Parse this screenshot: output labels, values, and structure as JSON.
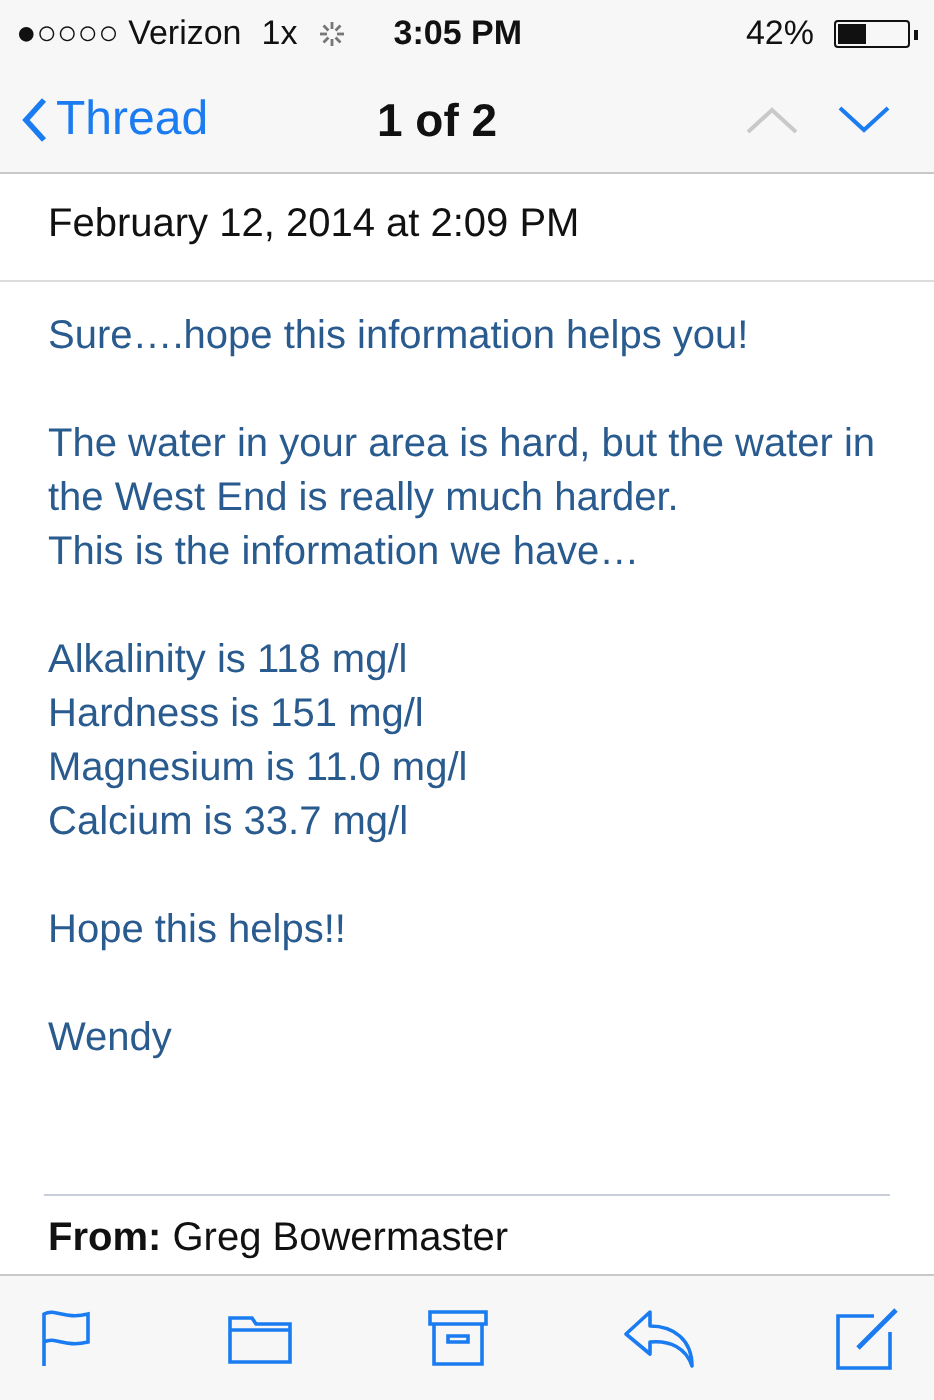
{
  "status_bar": {
    "carrier": "●○○○○ Verizon",
    "network": "1x",
    "time": "3:05 PM",
    "battery_percent": "42%"
  },
  "nav": {
    "back": "Thread",
    "position": "1 of 2",
    "previous_disabled": true,
    "next_disabled": false
  },
  "message": {
    "date": "February 12, 2014 at 2:09 PM",
    "paragraphs": [
      [
        "Sure….hope this information helps you!"
      ],
      [
        "The water in your area is hard, but the water in the West End is really much harder.",
        "This is the information we have…"
      ],
      [
        "Alkalinity  is 118 mg/l",
        "Hardness is  151 mg/l",
        "Magnesium is 11.0 mg/l",
        "Calcium is 33.7 mg/l"
      ],
      [
        "Hope this helps!!"
      ],
      [
        "Wendy"
      ]
    ],
    "quoted_from_label": "From:",
    "quoted_from": "Greg Bowermaster"
  }
}
